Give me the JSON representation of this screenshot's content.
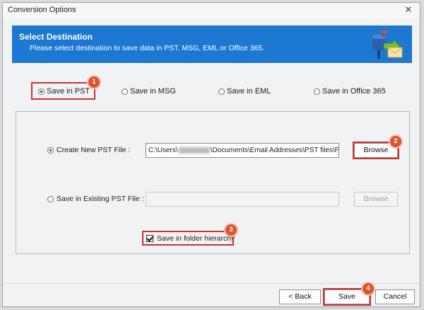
{
  "window": {
    "title": "Conversion Options",
    "close_glyph": "✕"
  },
  "banner": {
    "title": "Select Destination",
    "subtitle": "Please select destination to save data in PST, MSG, EML or Office 365.",
    "bg_color": "#1c78d1",
    "icon": "mailbox-arrow-icon"
  },
  "destination_options": [
    {
      "label": "Save in PST",
      "selected": true
    },
    {
      "label": "Save in MSG",
      "selected": false
    },
    {
      "label": "Save in EML",
      "selected": false
    },
    {
      "label": "Save in Office 365",
      "selected": false
    }
  ],
  "pst_options": {
    "create_new": {
      "label": "Create New PST File :",
      "selected": true
    },
    "path_prefix": "C:\\Users\\",
    "path_suffix": "\\Documents\\Email Addresses\\PST files\\PocoMa",
    "browse_label": "Browse",
    "existing": {
      "label": "Save in Existing PST File :",
      "selected": false
    },
    "existing_value": "",
    "browse_disabled_label": "Browse"
  },
  "folder_hierarchy": {
    "label": "Save in folder hierarchy",
    "checked": true
  },
  "footer": {
    "back_label": "< Back",
    "save_label": "Save",
    "cancel_label": "Cancel"
  },
  "callouts": [
    "1",
    "2",
    "3",
    "4"
  ],
  "accent_color": "#d0312d"
}
